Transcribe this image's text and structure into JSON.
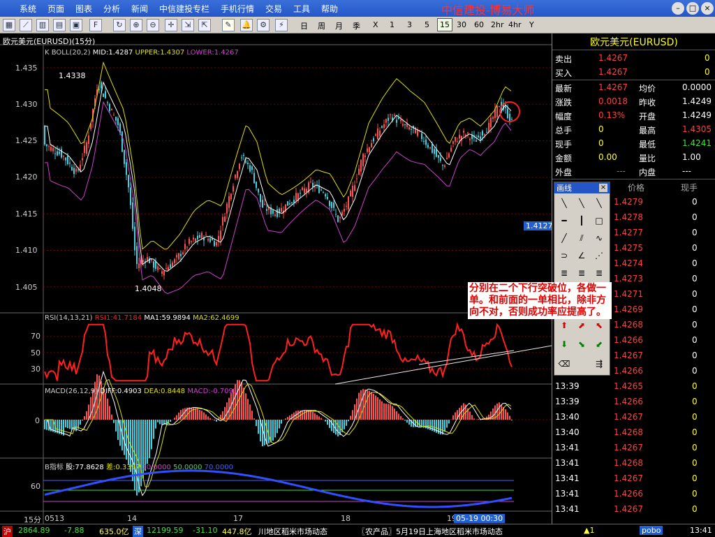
{
  "menu": [
    "系统",
    "页面",
    "图表",
    "分析",
    "新闻",
    "中信建投专栏",
    "手机行情",
    "交易",
    "工具",
    "帮助"
  ],
  "brand": "中信建投-博易大师",
  "window_buttons": [
    "–",
    "□",
    "×"
  ],
  "toolbar_periods": [
    "日",
    "周",
    "月",
    "季",
    "X",
    "1",
    "3",
    "5",
    "15",
    "30",
    "60",
    "2hr",
    "4hr",
    "Y"
  ],
  "toolbar_selected_period": "15",
  "chart": {
    "title": "欧元美元(EURUSD)(15分)",
    "boll_legend": {
      "name": "K  BOLL(20,2)",
      "mid": "MID:1.4287",
      "upper": "UPPER:1.4307",
      "lower": "LOWER:1.4267"
    },
    "price_ticks": [
      "1.435",
      "1.430",
      "1.425",
      "1.420",
      "1.415",
      "1.410",
      "1.405"
    ],
    "high_marker": "1.4338",
    "low_marker": "1.4048",
    "price_tag": "1.4127",
    "rsi_legend": {
      "name": "RSI(14,13,21)",
      "rsi1": "RSI1:41.7184",
      "ma1": "MA1:59.9894",
      "ma2": "MA2:62.4699"
    },
    "rsi_ticks": [
      "70",
      "50",
      "30"
    ],
    "macd_legend": {
      "name": "MACD(26,12,9)",
      "diff": "DIFF:0.4903",
      "dea": "DEA:0.8448",
      "macd": "MACD:-0.7091"
    },
    "macd_ticks": [
      "0"
    ],
    "b_legend": {
      "name": "B指标",
      "gu": "股:77.8628",
      "cha": "差:0.3397",
      "l1": "30.0000",
      "l2": "50.0000",
      "l3": "70.0000"
    },
    "b_ticks": [
      "60"
    ],
    "x_period": "15分",
    "x_ticks": [
      "0513",
      "14",
      "17",
      "18",
      "19"
    ],
    "cursor_time": "05-19 00:30"
  },
  "quote": {
    "title": "欧元美元(EURUSD)",
    "sell_label": "卖出",
    "sell_price": "1.4267",
    "sell_qty": "0",
    "buy_label": "买入",
    "buy_price": "1.4267",
    "buy_qty": "0",
    "rows": [
      {
        "l1": "最新",
        "v1": "1.4267",
        "l2": "均价",
        "v2": "0.0000"
      },
      {
        "l1": "涨跌",
        "v1": "0.0018",
        "l2": "昨收",
        "v2": "1.4249"
      },
      {
        "l1": "幅度",
        "v1": "0.13%",
        "l2": "开盘",
        "v2": "1.4249"
      },
      {
        "l1": "总手",
        "v1": "0",
        "l2": "最高",
        "v2": "1.4305"
      },
      {
        "l1": "现手",
        "v1": "0",
        "l2": "最低",
        "v2": "1.4241"
      },
      {
        "l1": "金额",
        "v1": "0.00",
        "l2": "量比",
        "v2": "1.00"
      },
      {
        "l1": "外盘",
        "v1": "---",
        "l2": "内盘",
        "v2": "---"
      }
    ],
    "tick_headers": [
      "价格",
      "现手"
    ],
    "ticks": [
      {
        "t": "",
        "p": "1.4279",
        "v": "0"
      },
      {
        "t": "",
        "p": "1.4278",
        "v": "0"
      },
      {
        "t": "",
        "p": "1.4277",
        "v": "0"
      },
      {
        "t": "",
        "p": "1.4275",
        "v": "0"
      },
      {
        "t": "",
        "p": "1.4274",
        "v": "0"
      },
      {
        "t": "",
        "p": "1.4273",
        "v": "0"
      },
      {
        "t": "",
        "p": "1.4271",
        "v": "0"
      },
      {
        "t": "",
        "p": "1.4269",
        "v": "0"
      },
      {
        "t": "",
        "p": "1.4268",
        "v": "0"
      },
      {
        "t": "",
        "p": "1.4266",
        "v": "0"
      },
      {
        "t": "",
        "p": "1.4267",
        "v": "0"
      },
      {
        "t": "",
        "p": "1.4266",
        "v": "0"
      },
      {
        "t": "13:39",
        "p": "1.4265",
        "v": "0"
      },
      {
        "t": "13:39",
        "p": "1.4266",
        "v": "0"
      },
      {
        "t": "13:40",
        "p": "1.4267",
        "v": "0"
      },
      {
        "t": "13:40",
        "p": "1.4268",
        "v": "0"
      },
      {
        "t": "13:41",
        "p": "1.4267",
        "v": "0"
      },
      {
        "t": "13:41",
        "p": "1.4268",
        "v": "0"
      },
      {
        "t": "13:41",
        "p": "1.4267",
        "v": "0"
      },
      {
        "t": "13:41",
        "p": "1.4266",
        "v": "0"
      },
      {
        "t": "13:41",
        "p": "1.4267",
        "v": "0"
      }
    ]
  },
  "drawtool": {
    "title": "画线",
    "close": "×"
  },
  "note": "分别在二个下行突破位，各做一单。和前面的一单相比，除非方向不对，否则成功率应提高了。",
  "status": {
    "sh_label": "沪",
    "sh_value": "2864.89",
    "sh_change": "-7.88",
    "sh_amount": "635.0亿",
    "sz_label": "深",
    "sz_value": "12199.59",
    "sz_change": "-31.10",
    "sz_amount": "447.8亿",
    "news1": "川地区稻米市场动态",
    "news2": "〖农产品〗5月19日上海地区稻米市场动态",
    "alert": "▲1",
    "logo": "pobo",
    "time": "13:41"
  },
  "colors": {
    "upper": "#e0e000",
    "mid": "#ffffff",
    "lower": "#d040d0",
    "up": "#ff5050",
    "down": "#40d0e0",
    "rsi": "#ff2020"
  }
}
